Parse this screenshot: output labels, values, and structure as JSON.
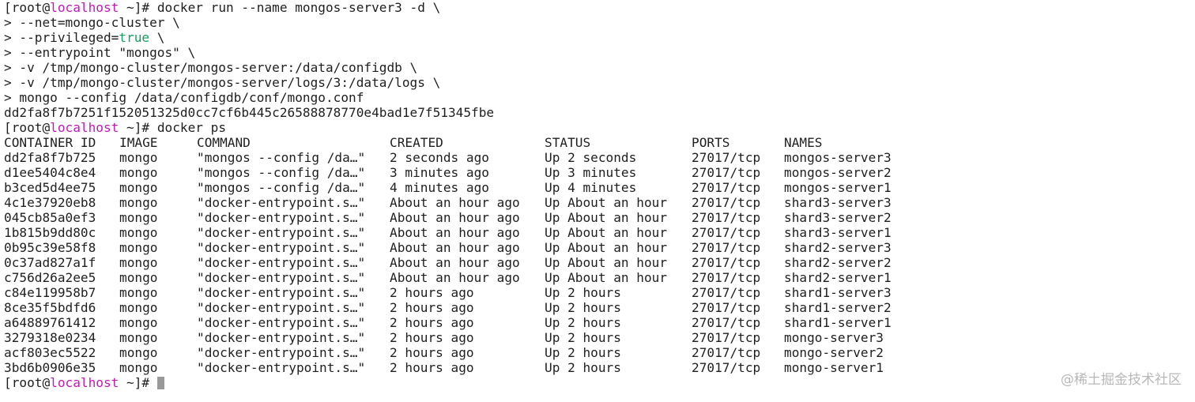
{
  "prompt": {
    "open": "[root@",
    "host": "localhost",
    "path_close": " ~]# "
  },
  "commands": {
    "run_first": "docker run --name mongos-server3 -d \\",
    "continuation": [
      "> --net=mongo-cluster \\",
      "> --privileged=",
      "> --entrypoint \"mongos\" \\",
      "> -v /tmp/mongo-cluster/mongos-server:/data/configdb \\",
      "> -v /tmp/mongo-cluster/mongos-server/logs/3:/data/logs \\",
      "> mongo --config /data/configdb/conf/mongo.conf"
    ],
    "privileged_value": "true",
    "privileged_tail": " \\",
    "container_hash": "dd2fa8f7b7251f152051325d0cc7cf6b445c26588878770e4bad1e7f51345fbe",
    "ps": "docker ps"
  },
  "table": {
    "headers": [
      "CONTAINER ID",
      "IMAGE",
      "COMMAND",
      "CREATED",
      "STATUS",
      "PORTS",
      "NAMES"
    ],
    "rows": [
      [
        "dd2fa8f7b725",
        "mongo",
        "\"mongos --config /da…\"",
        "2 seconds ago",
        "Up 2 seconds",
        "27017/tcp",
        "mongos-server3"
      ],
      [
        "d1ee5404c8e4",
        "mongo",
        "\"mongos --config /da…\"",
        "3 minutes ago",
        "Up 3 minutes",
        "27017/tcp",
        "mongos-server2"
      ],
      [
        "b3ced5d4ee75",
        "mongo",
        "\"mongos --config /da…\"",
        "4 minutes ago",
        "Up 4 minutes",
        "27017/tcp",
        "mongos-server1"
      ],
      [
        "4c1e37920eb8",
        "mongo",
        "\"docker-entrypoint.s…\"",
        "About an hour ago",
        "Up About an hour",
        "27017/tcp",
        "shard3-server3"
      ],
      [
        "045cb85a0ef3",
        "mongo",
        "\"docker-entrypoint.s…\"",
        "About an hour ago",
        "Up About an hour",
        "27017/tcp",
        "shard3-server2"
      ],
      [
        "1b815b9dd80c",
        "mongo",
        "\"docker-entrypoint.s…\"",
        "About an hour ago",
        "Up About an hour",
        "27017/tcp",
        "shard3-server1"
      ],
      [
        "0b95c39e58f8",
        "mongo",
        "\"docker-entrypoint.s…\"",
        "About an hour ago",
        "Up About an hour",
        "27017/tcp",
        "shard2-server3"
      ],
      [
        "0c37ad827a1f",
        "mongo",
        "\"docker-entrypoint.s…\"",
        "About an hour ago",
        "Up About an hour",
        "27017/tcp",
        "shard2-server2"
      ],
      [
        "c756d26a2ee5",
        "mongo",
        "\"docker-entrypoint.s…\"",
        "About an hour ago",
        "Up About an hour",
        "27017/tcp",
        "shard2-server1"
      ],
      [
        "c84e119958b7",
        "mongo",
        "\"docker-entrypoint.s…\"",
        "2 hours ago",
        "Up 2 hours",
        "27017/tcp",
        "shard1-server3"
      ],
      [
        "8ce35f5bdfd6",
        "mongo",
        "\"docker-entrypoint.s…\"",
        "2 hours ago",
        "Up 2 hours",
        "27017/tcp",
        "shard1-server2"
      ],
      [
        "a64889761412",
        "mongo",
        "\"docker-entrypoint.s…\"",
        "2 hours ago",
        "Up 2 hours",
        "27017/tcp",
        "shard1-server1"
      ],
      [
        "3279318e0234",
        "mongo",
        "\"docker-entrypoint.s…\"",
        "2 hours ago",
        "Up 2 hours",
        "27017/tcp",
        "mongo-server3"
      ],
      [
        "acf803ec5522",
        "mongo",
        "\"docker-entrypoint.s…\"",
        "2 hours ago",
        "Up 2 hours",
        "27017/tcp",
        "mongo-server2"
      ],
      [
        "3bd6b0906e35",
        "mongo",
        "\"docker-entrypoint.s…\"",
        "2 hours ago",
        "Up 2 hours",
        "27017/tcp",
        "mongo-server1"
      ]
    ]
  },
  "watermark": "@稀土掘金技术社区",
  "colors": {
    "host": "#c419b8",
    "true_keyword": "#12a05c",
    "text": "#1f1f1f",
    "cursor": "#999999"
  },
  "icons": {
    "cursor": "block-cursor-icon"
  }
}
